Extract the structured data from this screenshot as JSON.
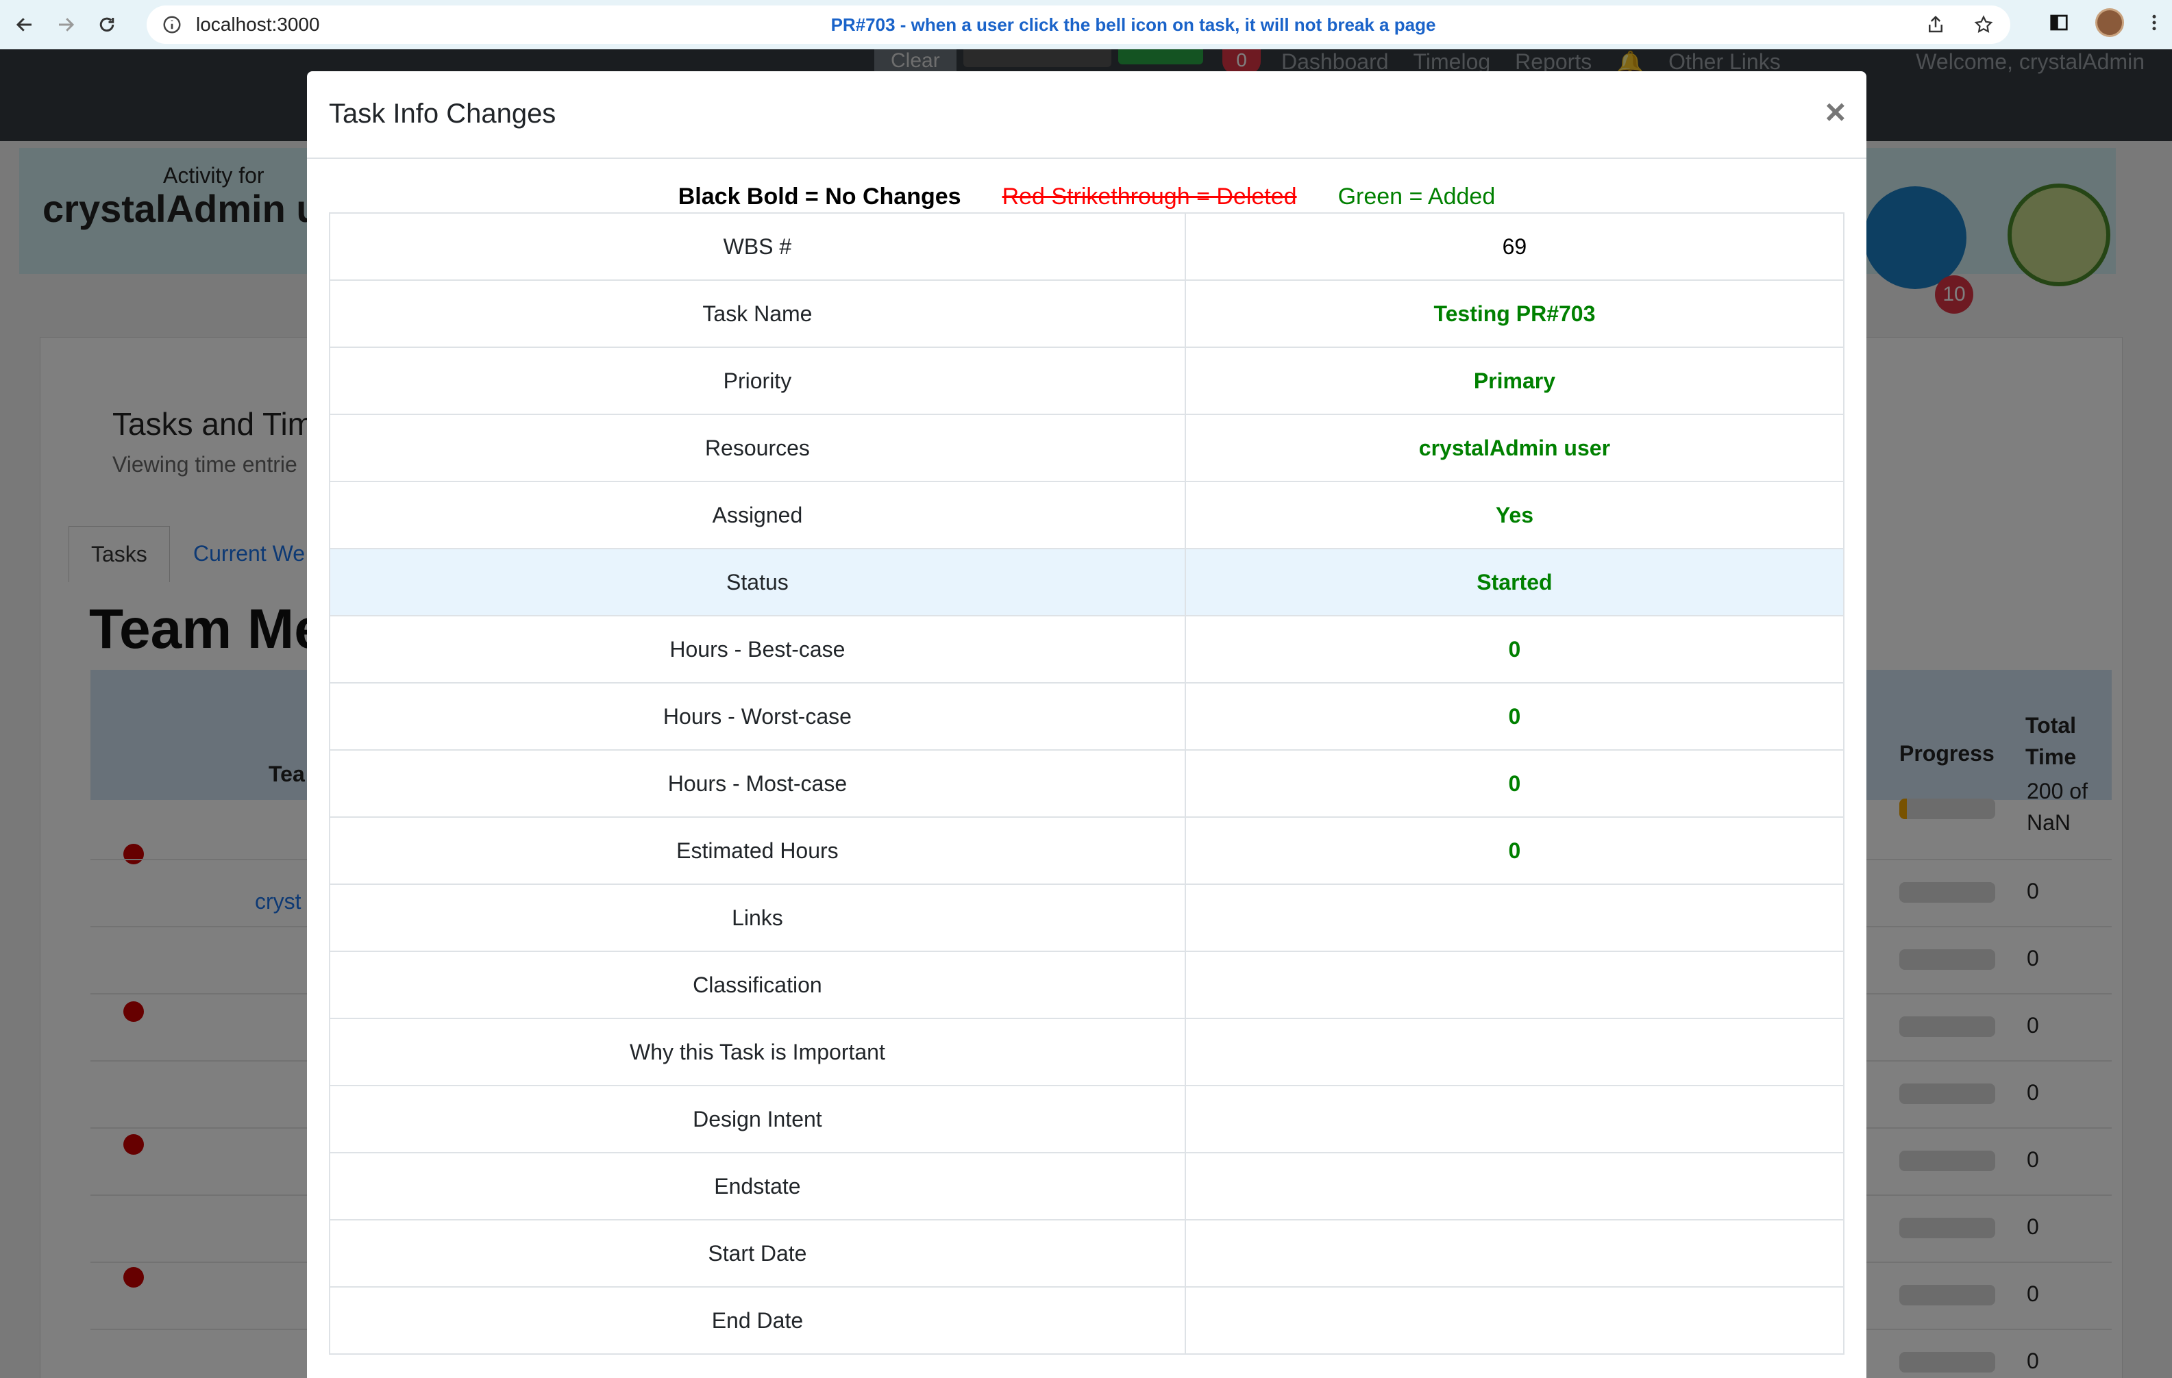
{
  "browser": {
    "url": "localhost:3000",
    "tab_title": "PR#703 - when a user click the bell icon on task, it will not break a page"
  },
  "background_app": {
    "nav": {
      "clear_label": "Clear",
      "notification_count": "0",
      "links": [
        "Dashboard",
        "Timelog",
        "Reports",
        "Other Links"
      ],
      "welcome": "Welcome, crystalAdmin"
    },
    "activity_for": "Activity for",
    "activity_user": "crystalAdmin us",
    "badge_count": "10",
    "card_title": "Tasks and Tim",
    "card_subtitle": "Viewing time entrie",
    "tabs": [
      "Tasks",
      "Current We"
    ],
    "team_heading": "Team Me",
    "table_headers": {
      "team": "Tea",
      "progress": "Progress",
      "total_time": [
        "Total",
        "Time"
      ]
    },
    "rows": [
      {
        "name": "cryst",
        "progress": 0.08,
        "total": [
          "200 of",
          "NaN"
        ]
      },
      {
        "name": "",
        "progress": 0,
        "total": [
          "0"
        ]
      },
      {
        "name": "",
        "progress": 0,
        "total": [
          "0"
        ]
      },
      {
        "name": "",
        "progress": 0,
        "total": [
          "0"
        ]
      },
      {
        "name": "",
        "progress": 0,
        "total": [
          "0"
        ]
      },
      {
        "name": "",
        "progress": 0,
        "total": [
          "0"
        ]
      },
      {
        "name": "",
        "progress": 0,
        "total": [
          "0"
        ]
      },
      {
        "name": "",
        "progress": 0,
        "total": [
          "0"
        ]
      },
      {
        "name": "",
        "progress": 0,
        "total": [
          "0"
        ]
      }
    ]
  },
  "modal": {
    "title": "Task Info Changes",
    "close_symbol": "×",
    "legend": {
      "black": "Black Bold = No Changes",
      "red": "Red Strikethrough = Deleted",
      "green": "Green = Added"
    },
    "rows": [
      {
        "label": "WBS #",
        "value": "69",
        "style": "plain"
      },
      {
        "label": "Task Name",
        "value": "Testing PR#703",
        "style": "added"
      },
      {
        "label": "Priority",
        "value": "Primary",
        "style": "added"
      },
      {
        "label": "Resources",
        "value": "crystalAdmin user",
        "style": "added"
      },
      {
        "label": "Assigned",
        "value": "Yes",
        "style": "added"
      },
      {
        "label": "Status",
        "value": "Started",
        "style": "added",
        "highlighted": true
      },
      {
        "label": "Hours - Best-case",
        "value": "0",
        "style": "added"
      },
      {
        "label": "Hours - Worst-case",
        "value": "0",
        "style": "added"
      },
      {
        "label": "Hours - Most-case",
        "value": "0",
        "style": "added"
      },
      {
        "label": "Estimated Hours",
        "value": "0",
        "style": "added"
      },
      {
        "label": "Links",
        "value": "",
        "style": "plain"
      },
      {
        "label": "Classification",
        "value": "",
        "style": "plain"
      },
      {
        "label": "Why this Task is Important",
        "value": "",
        "style": "plain"
      },
      {
        "label": "Design Intent",
        "value": "",
        "style": "plain"
      },
      {
        "label": "Endstate",
        "value": "",
        "style": "plain"
      },
      {
        "label": "Start Date",
        "value": "",
        "style": "plain"
      },
      {
        "label": "End Date",
        "value": "",
        "style": "plain"
      }
    ]
  },
  "colors": {
    "added": "#008000",
    "deleted": "#ff0000",
    "highlight_row": "#e8f4fd",
    "tab_title": "#1a63c9"
  }
}
